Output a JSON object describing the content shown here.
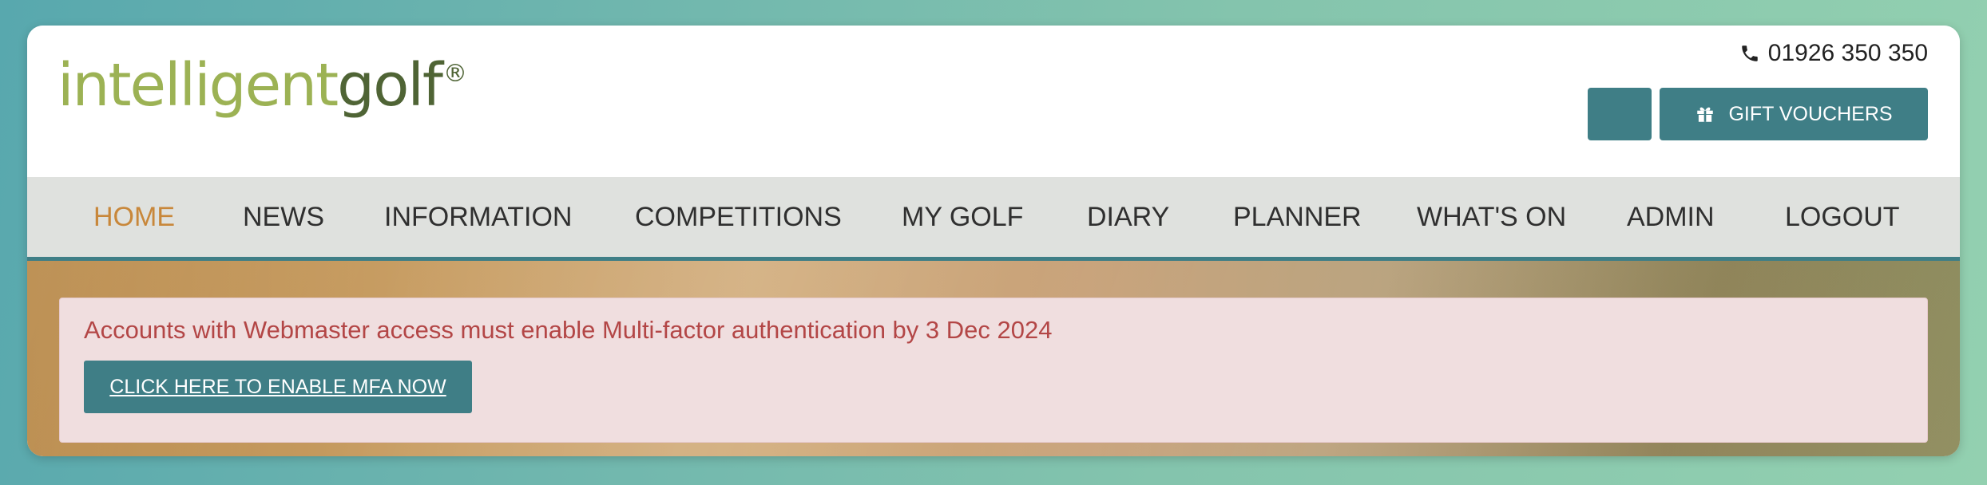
{
  "header": {
    "logo_part1": "intelligent",
    "logo_part2": "golf",
    "logo_mark": "®",
    "phone_icon": "phone-icon",
    "phone": "01926 350 350",
    "gift_icon": "gift-icon",
    "gift_vouchers_label": "GIFT VOUCHERS"
  },
  "nav": {
    "items": [
      {
        "label": "HOME",
        "active": true
      },
      {
        "label": "NEWS"
      },
      {
        "label": "INFORMATION"
      },
      {
        "label": "COMPETITIONS"
      },
      {
        "label": "MY GOLF"
      },
      {
        "label": "DIARY"
      },
      {
        "label": "PLANNER"
      },
      {
        "label": "WHAT'S ON"
      },
      {
        "label": "ADMIN"
      },
      {
        "label": "LOGOUT"
      }
    ]
  },
  "alert": {
    "message": "Accounts with Webmaster access must enable Multi-factor authentication by 3 Dec 2024",
    "button_label": "CLICK HERE TO ENABLE MFA NOW"
  },
  "colors": {
    "accent": "#3f7e86",
    "nav_active": "#c8873a",
    "alert_text": "#b34646",
    "alert_bg": "#f0dedf",
    "logo_light": "#9cb254",
    "logo_dark": "#4f6435"
  }
}
